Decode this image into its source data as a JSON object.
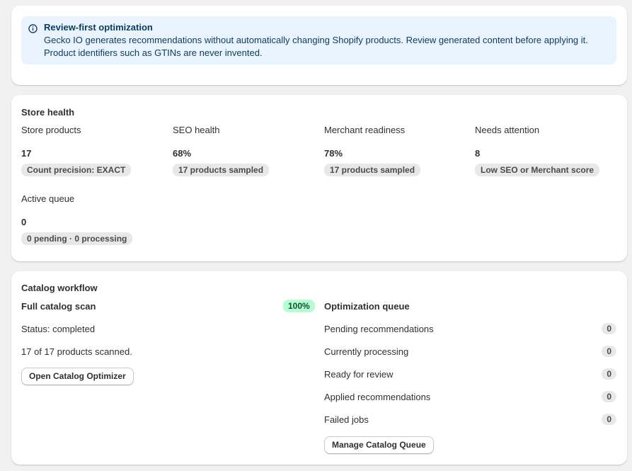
{
  "banner": {
    "title": "Review-first optimization",
    "text": "Gecko IO generates recommendations without automatically changing Shopify products. Review generated content before applying it. Product identifiers such as GTINs are never invented.",
    "icon": "info-icon"
  },
  "store_health": {
    "title": "Store health",
    "metrics": [
      {
        "label": "Store products",
        "value": "17",
        "badge": "Count precision: EXACT"
      },
      {
        "label": "SEO health",
        "value": "68%",
        "badge": "17 products sampled"
      },
      {
        "label": "Merchant readiness",
        "value": "78%",
        "badge": "17 products sampled"
      },
      {
        "label": "Needs attention",
        "value": "8",
        "badge": "Low SEO or Merchant score"
      },
      {
        "label": "Active queue",
        "value": "0",
        "badge": "0 pending · 0 processing"
      }
    ]
  },
  "catalog_workflow": {
    "title": "Catalog workflow",
    "scan": {
      "title": "Full catalog scan",
      "percent": "100%",
      "status": "Status: completed",
      "progress_text": "17 of 17 products scanned.",
      "button": "Open Catalog Optimizer"
    },
    "queue": {
      "title": "Optimization queue",
      "rows": [
        {
          "label": "Pending recommendations",
          "count": "0"
        },
        {
          "label": "Currently processing",
          "count": "0"
        },
        {
          "label": "Ready for review",
          "count": "0"
        },
        {
          "label": "Applied recommendations",
          "count": "0"
        },
        {
          "label": "Failed jobs",
          "count": "0"
        }
      ],
      "button": "Manage Catalog Queue"
    }
  },
  "colors": {
    "banner_bg": "#eaf4ff",
    "success_badge_bg": "#b4fed2",
    "neutral_badge_bg": "#e8e8e8"
  }
}
